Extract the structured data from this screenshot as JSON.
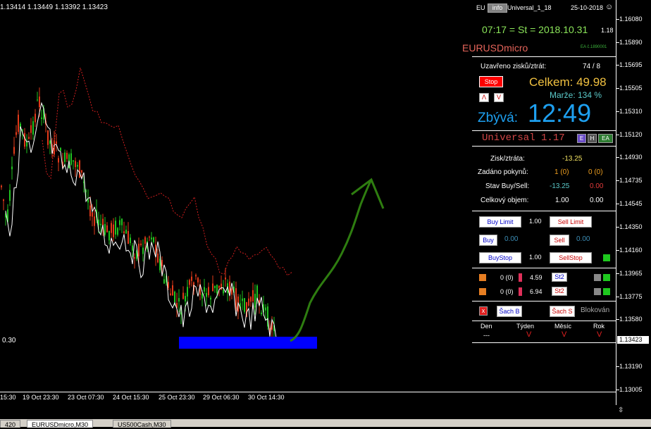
{
  "chart": {
    "ohlc": "1.13414 1.13449 1.13392 1.13423",
    "left_price": "0.30",
    "price_ticks": [
      "1.16080",
      "1.15890",
      "1.15695",
      "1.15505",
      "1.15310",
      "1.15120",
      "1.14930",
      "1.14735",
      "1.14545",
      "1.14350",
      "1.14160",
      "1.13965",
      "1.13775",
      "1.13580",
      "1.13423",
      "1.13190",
      "1.13005"
    ],
    "current_price": "1.13423",
    "time_labels": [
      "15:30",
      "19 Oct 23:30",
      "23 Oct 07:30",
      "24 Oct 15:30",
      "25 Oct 23:30",
      "29 Oct 06:30",
      "30 Oct 14:30"
    ],
    "colors": {
      "bull": "#21c421",
      "bear": "#e23a1a",
      "white_line": "#ffffff",
      "dotted": "#d21e1e",
      "arrow": "#2e7d10",
      "box": "#0000ff"
    }
  },
  "tabs": [
    "420",
    "EURUSDmicro,M30",
    "US500Cash,M30"
  ],
  "panel": {
    "header_left": "EU",
    "header_info": "info",
    "header_mid": "Universal_1_18",
    "header_date": "25-10-2018",
    "smile_icon": "smile-icon",
    "time_line": "07:17 = St = 2018.10.31",
    "time_suffix": "1.18",
    "symbol": "EURUSDmicro",
    "ea_code": "EA č.1890001",
    "closed_label": "Uzavřeno zisků/ztrát:",
    "closed_value": "74 / 8",
    "stop_label": "Stop",
    "total_label": "Celkem: 49.98",
    "up_label": "Λ",
    "down_label": "V",
    "margin_label": "Marže:  134 %",
    "remain_label": "Zbývá:",
    "remain_value": "12:49",
    "universal_label": "Universal 1.17",
    "mini_buttons": [
      "E",
      "H",
      "EA"
    ],
    "rows": [
      {
        "label": "Zisk/ztráta:",
        "v1": "-13.25",
        "v2": ""
      },
      {
        "label": "Zadáno pokynů:",
        "v1": "1 (0)",
        "v2": "0 (0)"
      },
      {
        "label": "Stav Buy/Sell:",
        "v1": "-13.25",
        "v2": "0.00"
      },
      {
        "label": "Celkový objem:",
        "v1": "1.00",
        "v2": "0.00"
      }
    ],
    "order_rows": [
      {
        "left": "Buy Limit",
        "lv": "1.00",
        "right": "Sell Limit",
        "rv": ""
      },
      {
        "left": "Buy",
        "lv": "0.00",
        "right": "Sell",
        "rv": "0.00"
      },
      {
        "left": "BuyStop",
        "lv": "1.00",
        "right": "SellStop",
        "rv": ""
      }
    ],
    "st_rows": [
      {
        "count": "0 (0)",
        "value": "4.59",
        "btn": "St2"
      },
      {
        "count": "0 (0)",
        "value": "6.94",
        "btn": "St2"
      }
    ],
    "sach_b": "Šach B",
    "sach_s": "Šach S",
    "blocked": "Blokován",
    "x_label": "x",
    "periods": [
      {
        "name": "Den",
        "value": "---"
      },
      {
        "name": "Týden",
        "value": "V"
      },
      {
        "name": "Měsíc",
        "value": "V"
      },
      {
        "name": "Rok",
        "value": "V"
      }
    ]
  }
}
